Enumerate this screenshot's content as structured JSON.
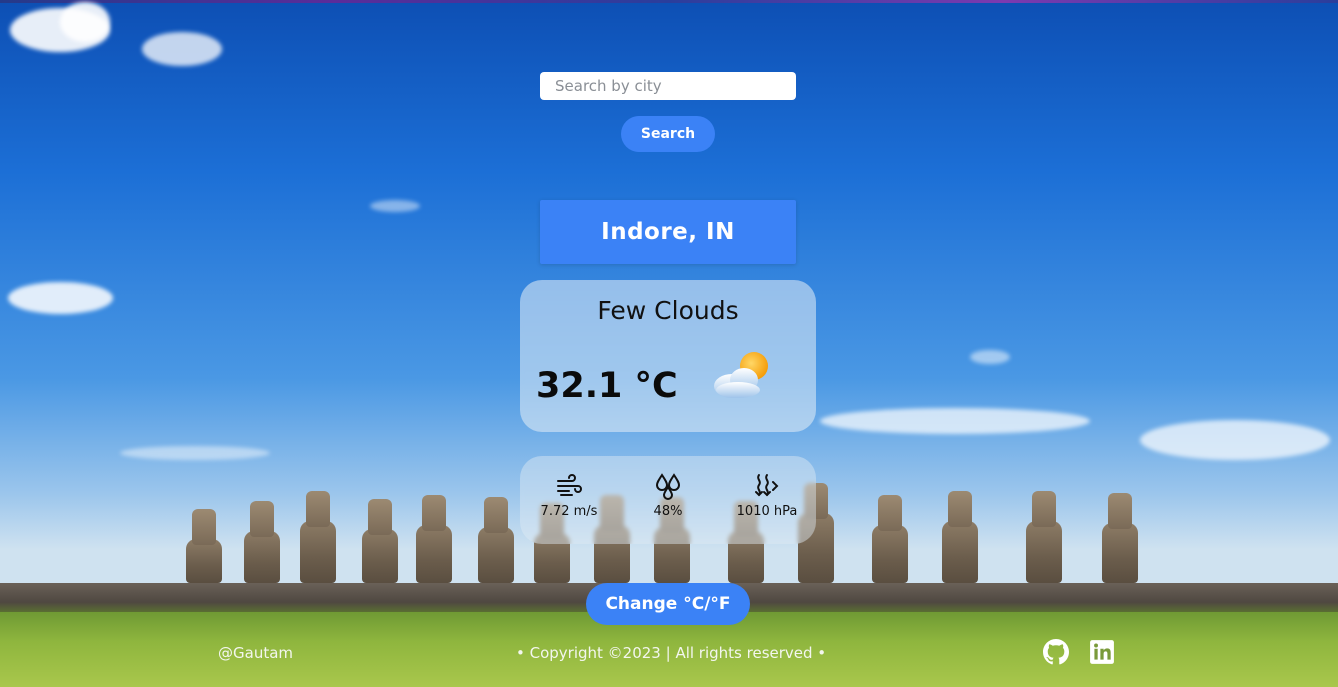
{
  "search": {
    "placeholder": "Search by city",
    "button_label": "Search"
  },
  "location": {
    "city": "Indore, IN"
  },
  "weather": {
    "condition": "Few Clouds",
    "temperature": "32.1 °C",
    "icon": "few-clouds-sun-icon",
    "wind": {
      "value": "7.72 m/s",
      "icon": "wind-icon"
    },
    "humidity": {
      "value": "48%",
      "icon": "humidity-drops-icon"
    },
    "pressure": {
      "value": "1010 hPa",
      "icon": "pressure-icon"
    }
  },
  "toggle": {
    "label": "Change °C/°F"
  },
  "footer": {
    "author": "@Gautam",
    "copyright": "• Copyright ©2023 | All rights reserved •",
    "links": [
      {
        "icon": "github-icon"
      },
      {
        "icon": "linkedin-icon"
      }
    ]
  },
  "colors": {
    "accent": "#3b82f6",
    "sky": "#1c6fd6"
  }
}
